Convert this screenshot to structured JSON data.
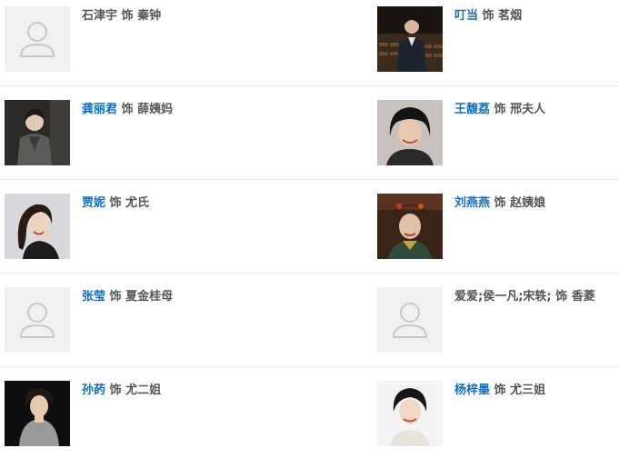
{
  "connector": "饰",
  "cast": [
    {
      "actor": "石津宇",
      "role": "秦钟",
      "linked": false,
      "photo": "placeholder-avatar"
    },
    {
      "actor": "叮当",
      "role": "茗烟",
      "linked": true,
      "photo": "portrait-photo"
    },
    {
      "actor": "龚丽君",
      "role": "薛姨妈",
      "linked": true,
      "photo": "portrait-photo"
    },
    {
      "actor": "王馥荔",
      "role": "邢夫人",
      "linked": true,
      "photo": "portrait-photo"
    },
    {
      "actor": "贾妮",
      "role": "尤氏",
      "linked": true,
      "photo": "portrait-photo"
    },
    {
      "actor": "刘燕燕",
      "role": "赵姨娘",
      "linked": true,
      "photo": "portrait-photo"
    },
    {
      "actor": "张莹",
      "role": "夏金桂母",
      "linked": true,
      "photo": "placeholder-avatar"
    },
    {
      "actor": "爱爱;侯一凡;宋轶;",
      "role": "香菱",
      "linked": false,
      "photo": "placeholder-avatar"
    },
    {
      "actor": "孙菂",
      "role": "尤二姐",
      "linked": true,
      "photo": "portrait-photo"
    },
    {
      "actor": "杨梓墨",
      "role": "尤三姐",
      "linked": true,
      "photo": "portrait-photo"
    }
  ],
  "colors": {
    "link": "#136ec2",
    "text": "#555555",
    "divider": "#e8e8e8",
    "placeholder_bg": "#f0f0f0",
    "placeholder_icon": "#c8c8c8"
  }
}
